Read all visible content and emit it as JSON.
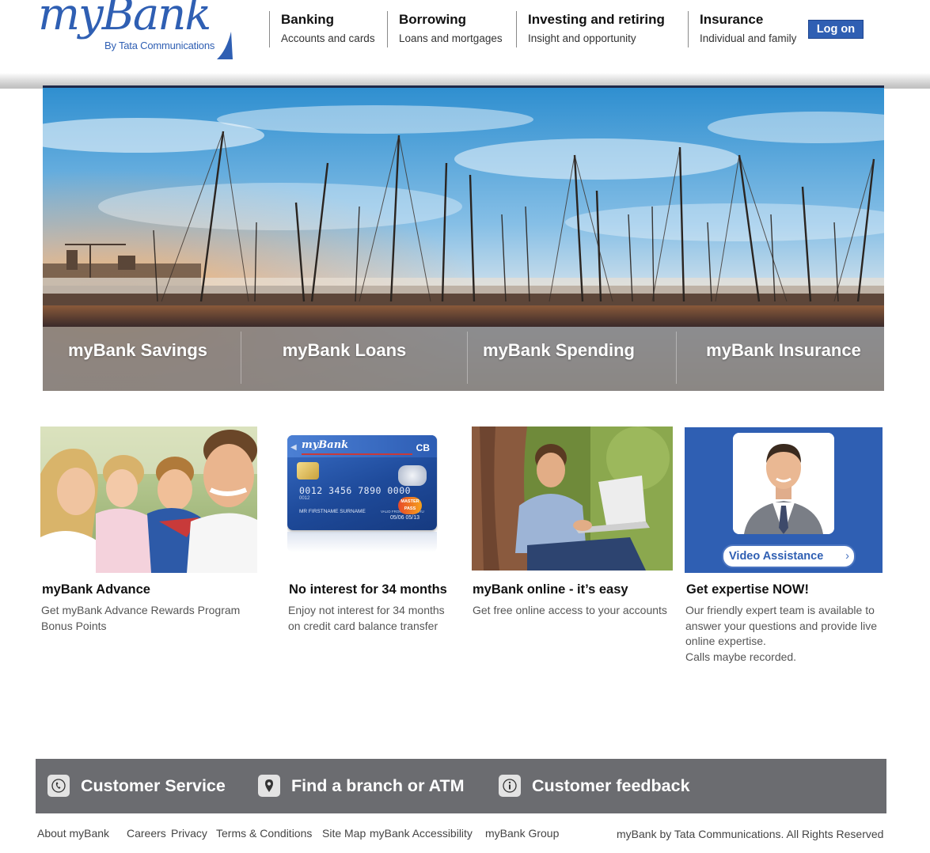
{
  "brand": {
    "logo": "myBank",
    "tagline": "By Tata Communications",
    "color": "#2f5fb3"
  },
  "nav": [
    {
      "title": "Banking",
      "subtitle": "Accounts and cards"
    },
    {
      "title": "Borrowing",
      "subtitle": "Loans and mortgages"
    },
    {
      "title": "Investing and retiring",
      "subtitle": "Insight and opportunity"
    },
    {
      "title": "Insurance",
      "subtitle": "Individual and family"
    }
  ],
  "logon_label": "Log on",
  "hero": {
    "image": "marina-sailboats-sunset-photo",
    "tabs": [
      "myBank Savings",
      "myBank Loans",
      "myBank Spending",
      "myBank Insurance"
    ]
  },
  "promos": [
    {
      "image": "family-photo",
      "title": "myBank Advance",
      "desc_lines": [
        "Get myBank Advance Rewards Program",
        "Bonus Points"
      ]
    },
    {
      "image": "credit-card-image",
      "card_brand": "myBank",
      "card_number": "0012 3456 7890 0000",
      "card_small": "0012",
      "card_name": "MR FIRSTNAME SURNAME",
      "card_valid_label": "VALID FROM   VALID THRU",
      "card_dates": "05/06  05/13",
      "card_network": "MASTER PASS",
      "card_badge": "CB",
      "title": "No interest for 34 months",
      "desc_lines": [
        "Enjoy not interest for 34 months",
        "on credit card balance transfer"
      ]
    },
    {
      "image": "man-with-laptop-photo",
      "title": "myBank online - it’s easy",
      "desc_lines": [
        "Get free online access to your accounts"
      ]
    },
    {
      "image": "agent-portrait-photo",
      "video_label": "Video Assistance",
      "title": "Get expertise NOW!",
      "desc_lines": [
        "Our friendly expert team is available to",
        "answer your questions and provide live",
        "online expertise.",
        "Calls maybe recorded."
      ]
    }
  ],
  "footer_bar": [
    {
      "icon": "phone-icon",
      "label": "Customer Service"
    },
    {
      "icon": "location-pin-icon",
      "label": "Find a branch or ATM"
    },
    {
      "icon": "info-icon",
      "label": "Customer feedback"
    }
  ],
  "footer_links": [
    "About myBank",
    "Careers",
    "Privacy",
    "Terms & Conditions",
    "Site Map",
    "myBank Accessibility",
    "myBank Group"
  ],
  "copyright": "myBank by Tata Communications. All Rights Reserved"
}
